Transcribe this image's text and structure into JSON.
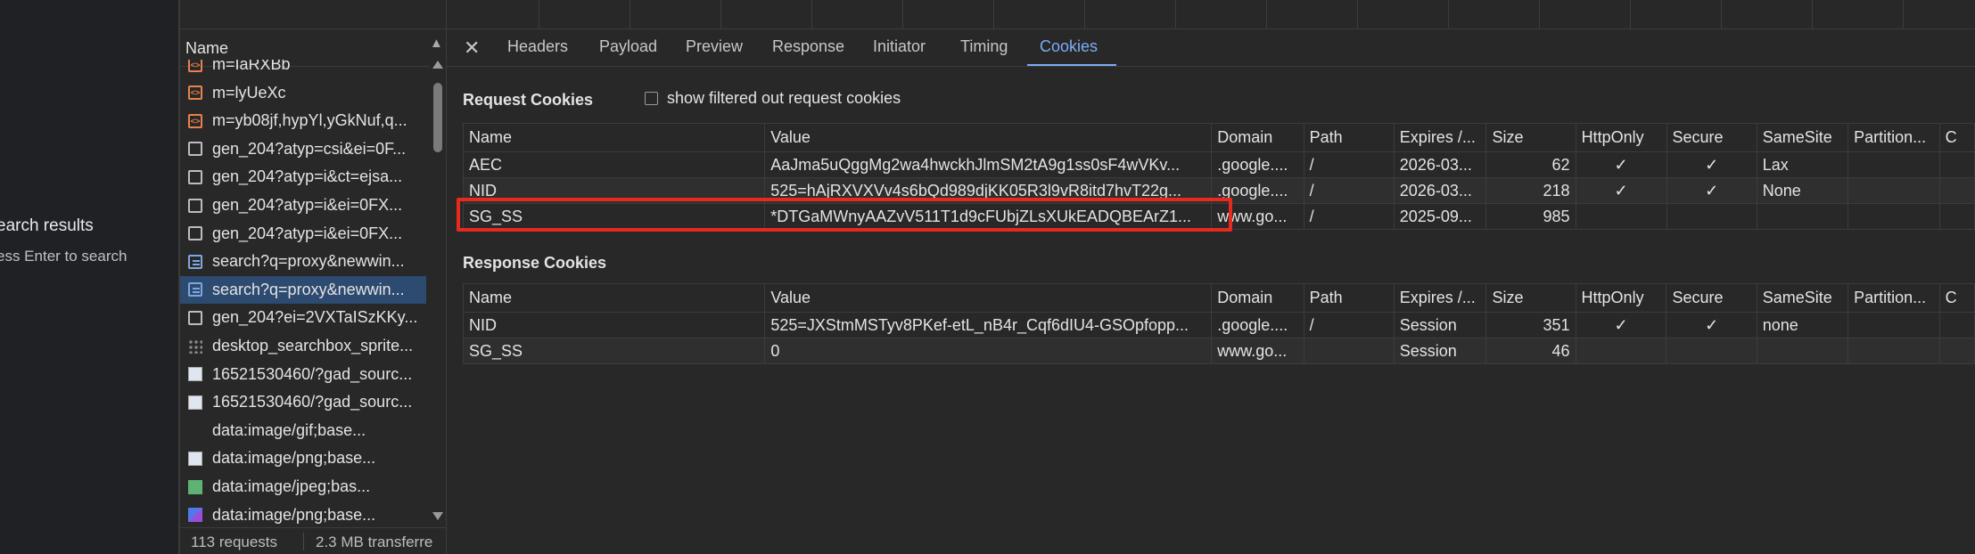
{
  "page": {
    "title": "earch results",
    "subtitle": "ess Enter to search"
  },
  "requests": {
    "header": "Name",
    "items": [
      {
        "name": "m=IaRXBb",
        "icon": "script-icon"
      },
      {
        "name": "m=lyUeXc",
        "icon": "script-icon"
      },
      {
        "name": "m=yb08jf,hypYl,yGkNuf,q...",
        "icon": "script-icon"
      },
      {
        "name": "gen_204?atyp=csi&ei=0F...",
        "icon": "xhr-icon"
      },
      {
        "name": "gen_204?atyp=i&ct=ejsa...",
        "icon": "xhr-icon"
      },
      {
        "name": "gen_204?atyp=i&ei=0FX...",
        "icon": "xhr-icon"
      },
      {
        "name": "gen_204?atyp=i&ei=0FX...",
        "icon": "xhr-icon"
      },
      {
        "name": "search?q=proxy&newwin...",
        "icon": "document-icon"
      },
      {
        "name": "search?q=proxy&newwin...",
        "icon": "document-icon"
      },
      {
        "name": "gen_204?ei=2VXTaISzKKy...",
        "icon": "xhr-icon"
      },
      {
        "name": "desktop_searchbox_sprite...",
        "icon": "image-icon"
      },
      {
        "name": "16521530460/?gad_sourc...",
        "icon": "image-icon"
      },
      {
        "name": "16521530460/?gad_sourc...",
        "icon": "image-icon"
      },
      {
        "name": "data:image/gif;base...",
        "icon": "image-icon"
      },
      {
        "name": "data:image/png;base...",
        "icon": "image-icon"
      },
      {
        "name": "data:image/jpeg;bas...",
        "icon": "image-icon"
      },
      {
        "name": "data:image/png;base...",
        "icon": "image-icon"
      }
    ],
    "selected_index": 8,
    "status_count": "113 requests",
    "status_transfer": "2.3 MB transferre"
  },
  "tabs": {
    "close_label": "✕",
    "items": [
      "Headers",
      "Payload",
      "Preview",
      "Response",
      "Initiator",
      "Timing",
      "Cookies"
    ],
    "active": "Cookies"
  },
  "request_cookies": {
    "title": "Request Cookies",
    "filter_label": "show filtered out request cookies",
    "columns": [
      "Name",
      "Value",
      "Domain",
      "Path",
      "Expires /...",
      "Size",
      "HttpOnly",
      "Secure",
      "SameSite",
      "Partition...",
      "C"
    ],
    "rows": [
      [
        "AEC",
        "AaJma5uQggMg2wa4hwckhJlmSM2tA9g1ss0sF4wVKv...",
        ".google....",
        "/",
        "2026-03...",
        "62",
        "✓",
        "✓",
        "Lax",
        "",
        ""
      ],
      [
        "NID",
        "525=hAjRXVXVv4s6bQd989djKK05R3l9vR8itd7hvT22g...",
        ".google....",
        "/",
        "2026-03...",
        "218",
        "✓",
        "✓",
        "None",
        "",
        ""
      ],
      [
        "SG_SS",
        "*DTGaMWnyAAZvV511T1d9cFUbjZLsXUkEADQBEArZ1...",
        "www.go...",
        "/",
        "2025-09...",
        "985",
        "",
        "",
        "",
        "",
        ""
      ]
    ]
  },
  "response_cookies": {
    "title": "Response Cookies",
    "columns": [
      "Name",
      "Value",
      "Domain",
      "Path",
      "Expires /...",
      "Size",
      "HttpOnly",
      "Secure",
      "SameSite",
      "Partition...",
      "C"
    ],
    "rows": [
      [
        "NID",
        "525=JXStmMSTyv8PKef-etL_nB4r_Cqf6dIU4-GSOpfopp...",
        ".google....",
        "/",
        "Session",
        "351",
        "✓",
        "✓",
        "none",
        "",
        ""
      ],
      [
        "SG_SS",
        "0",
        "www.go...",
        "",
        "Session",
        "46",
        "",
        "",
        "",
        "",
        ""
      ]
    ]
  },
  "colors": {
    "accent": "#7cacf8",
    "highlight": "#e8291e",
    "selected_row": "#2d4a70"
  }
}
